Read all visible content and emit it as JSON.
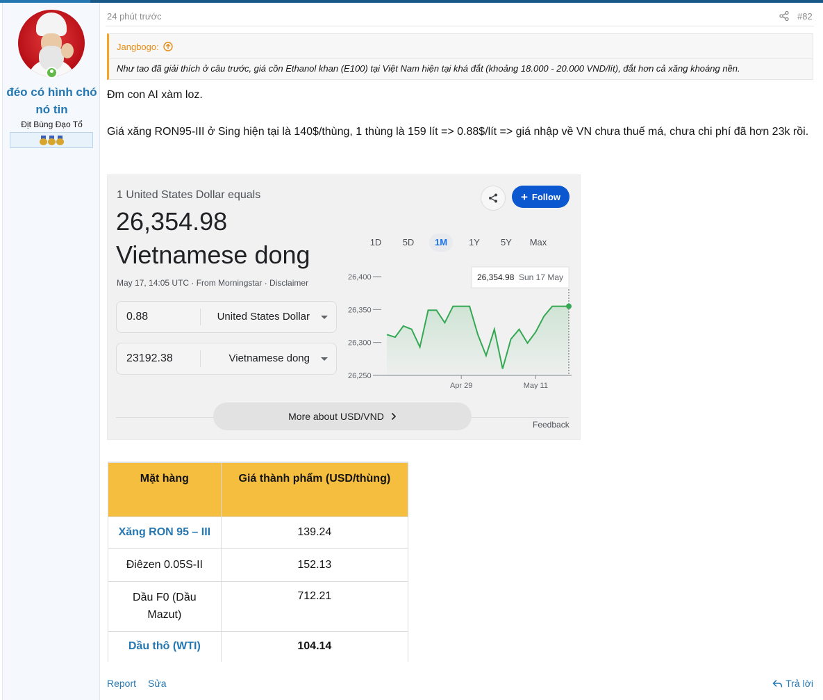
{
  "post": {
    "time": "24 phút trước",
    "number": "#82"
  },
  "user": {
    "name": "đéo có hình chó nó tin",
    "title": "Địt Bùng Đạo Tổ"
  },
  "quote": {
    "author": "Jangbogo:",
    "text": "Như tao đã giải thích ở câu trước, giá cồn Ethanol khan (E100) tại Việt Nam hiện tại khá đắt (khoảng 18.000 - 20.000 VND/lít), đắt hơn cả xăng khoáng nền."
  },
  "body": {
    "line1": "Đm con AI xàm loz.",
    "line2": "Giá xăng RON95-III ở Sing hiện tại là 140$/thùng, 1 thùng là 159 lít => 0.88$/lít => giá nhập về VN chưa thuế má, chưa chi phí đã hơn 23k rồi."
  },
  "converter": {
    "equals_text": "1 United States Dollar equals",
    "amount": "26,354.98",
    "currency_name": "Vietnamese dong",
    "timestamp": "May 17, 14:05 UTC · From Morningstar · Disclaimer",
    "follow_label": "Follow",
    "from_value": "0.88",
    "from_currency": "United States Dollar",
    "to_value": "23192.38",
    "to_currency": "Vietnamese dong",
    "ranges": [
      "1D",
      "5D",
      "1M",
      "1Y",
      "5Y",
      "Max"
    ],
    "active_range": "1M",
    "more_label": "More about USD/VND",
    "feedback_label": "Feedback",
    "tooltip_value": "26,354.98",
    "tooltip_date": "Sun 17 May",
    "accent": "#0b57d0",
    "line_color": "#34a853"
  },
  "chart_data": {
    "type": "line",
    "x": [
      "Apr 17",
      "Apr 18",
      "Apr 19",
      "Apr 20",
      "Apr 21",
      "Apr 22",
      "Apr 23",
      "Apr 24",
      "Apr 25",
      "Apr 26",
      "Apr 27",
      "Apr 28",
      "Apr 29",
      "Apr 30",
      "May 1",
      "May 2",
      "May 3",
      "May 4",
      "May 5",
      "May 6",
      "May 7",
      "May 8",
      "May 9",
      "May 10",
      "May 11",
      "May 12",
      "May 13",
      "May 14",
      "May 15",
      "May 16",
      "May 17"
    ],
    "values": [
      26312,
      26308,
      26325,
      26320,
      26293,
      26349,
      26349,
      26330,
      26355,
      26355,
      26355,
      26312,
      26280,
      26320,
      26260,
      26305,
      26320,
      26299,
      26316,
      26340,
      26355,
      26355,
      26355
    ],
    "xticks": [
      "Apr 29",
      "May 11"
    ],
    "yticks": [
      26250,
      26300,
      26350,
      26400
    ],
    "ytick_labels": [
      "26,250",
      "26,300",
      "26,350",
      "26,400"
    ],
    "ylim": [
      26250,
      26400
    ],
    "grid": false
  },
  "table": {
    "headers": [
      "Mặt hàng",
      "Giá thành phẩm (USD/thùng)"
    ],
    "rows": [
      {
        "item": "Xăng RON 95 – III",
        "price": "139.24"
      },
      {
        "item": "Điêzen 0.05S-II",
        "price": "152.13"
      },
      {
        "item": "Dầu F0 (Dầu Mazut)",
        "price": "712.21"
      },
      {
        "item": "Dầu thô (WTI)",
        "price": "104.14"
      }
    ]
  },
  "actions": {
    "report": "Report",
    "edit": "Sửa",
    "reply": "Trả lời"
  },
  "colors": {
    "link": "#2577b1",
    "quote_accent": "#f6a623",
    "table_header": "#f5be3f"
  }
}
